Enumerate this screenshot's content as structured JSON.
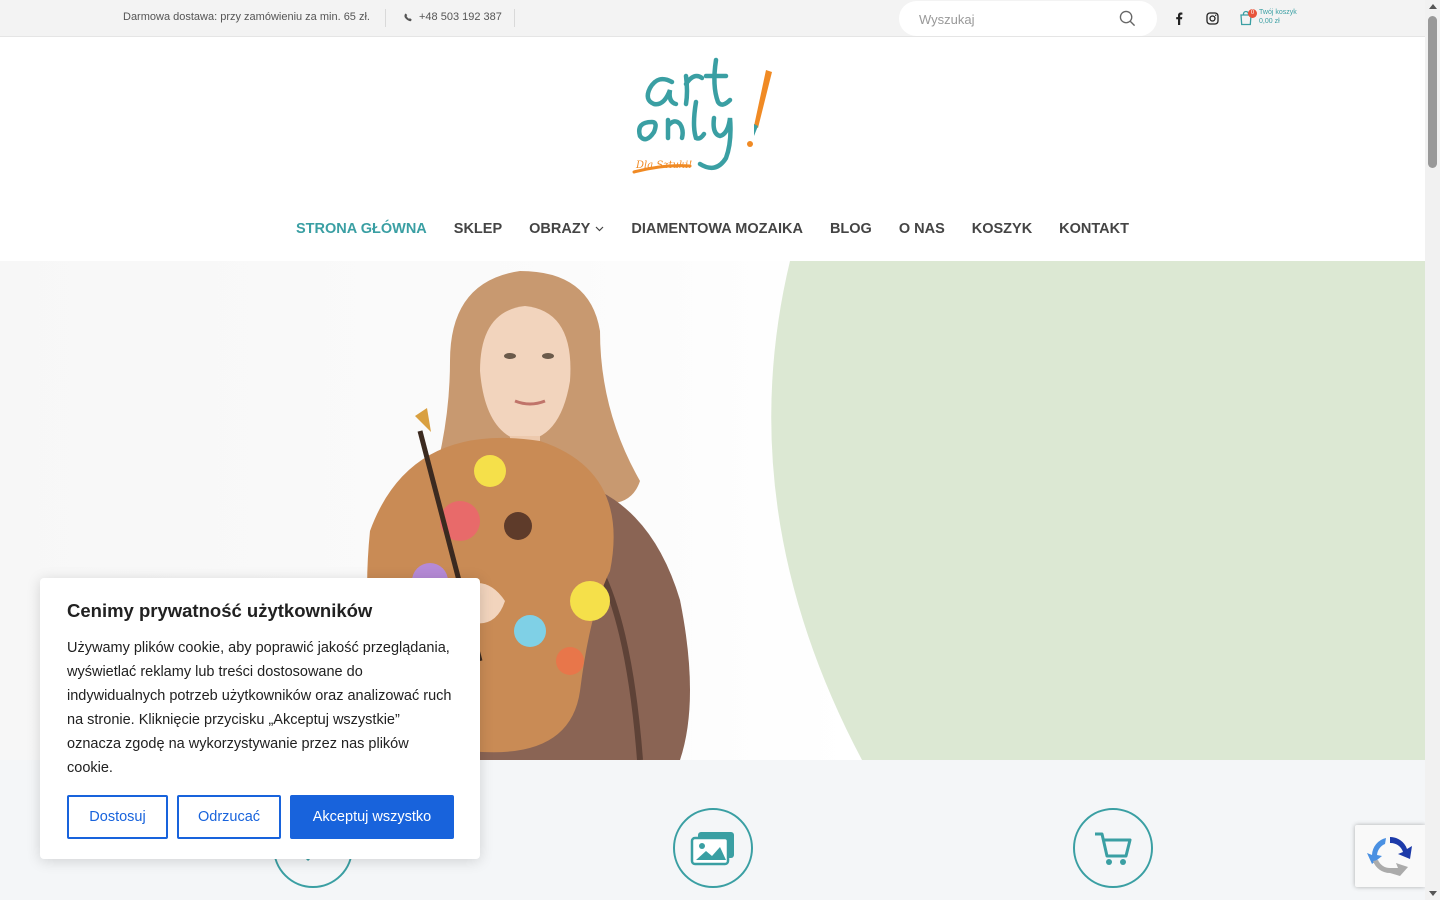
{
  "topbar": {
    "shipping_text": "Darmowa dostawa: przy zamówieniu za min. 65 zł.",
    "phone": "+48 503 192 387",
    "search_placeholder": "Wyszukaj",
    "cart_label": "Twój koszyk",
    "cart_value": "0,00 zł",
    "cart_count": "0"
  },
  "logo": {
    "alt": "art only",
    "tagline": "Dla Sztuki!"
  },
  "nav": {
    "items": [
      {
        "label": "STRONA GŁÓWNA",
        "active": true
      },
      {
        "label": "SKLEP"
      },
      {
        "label": "OBRAZY",
        "dropdown": true
      },
      {
        "label": "DIAMENTOWA MOZAIKA"
      },
      {
        "label": "BLOG"
      },
      {
        "label": "O NAS"
      },
      {
        "label": "KOSZYK"
      },
      {
        "label": "KONTAKT"
      }
    ]
  },
  "colors": {
    "accent": "#3a9fa3",
    "hero_green": "#dce8d3",
    "cookie_blue": "#1863dc"
  },
  "features": {
    "icons": [
      "arrow-icon",
      "images-icon",
      "cart-icon"
    ]
  },
  "cookie": {
    "title": "Cenimy prywatność użytkowników",
    "body": "Używamy plików cookie, aby poprawić jakość przeglądania, wyświetlać reklamy lub treści dostosowane do indywidualnych potrzeb użytkowników oraz analizować ruch na stronie. Kliknięcie przycisku „Akceptuj wszystkie” oznacza zgodę na wykorzystywanie przez nas plików cookie.",
    "customize": "Dostosuj",
    "reject": "Odrzucać",
    "accept": "Akceptuj wszystko"
  }
}
